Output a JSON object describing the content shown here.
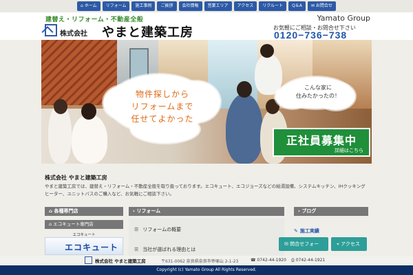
{
  "nav": {
    "items": [
      {
        "icon": "home-icon",
        "glyph": "🏠",
        "label": "ホーム"
      },
      {
        "icon": "",
        "glyph": "",
        "label": "リフォーム"
      },
      {
        "icon": "",
        "glyph": "",
        "label": "施工事例"
      },
      {
        "icon": "",
        "glyph": "",
        "label": "ご挨拶"
      },
      {
        "icon": "",
        "glyph": "",
        "label": "会社情報"
      },
      {
        "icon": "",
        "glyph": "",
        "label": "営業エリア"
      },
      {
        "icon": "",
        "glyph": "",
        "label": "アクセス"
      },
      {
        "icon": "",
        "glyph": "",
        "label": "リクルート"
      },
      {
        "icon": "",
        "glyph": "",
        "label": "Q＆A"
      },
      {
        "icon": "mail-icon",
        "glyph": "✉",
        "label": "お問合せ"
      }
    ]
  },
  "header": {
    "tagline": "建替え・リフォーム・不動産全般",
    "company_prefix": "株式会社",
    "company_name": "やまと建築工房",
    "group": "Yamato Group",
    "contact_hint": "お気軽にご相談・お問合せ下さい",
    "phone": "0120−736−738"
  },
  "hero": {
    "cloud_text": "物件探しから\nリフォームまで\n任せてよかった",
    "cloud2_text": "こんな家に\n住みたかったの！",
    "recruit_title": "正社員募集中",
    "recruit_sub": "詳細はこちら"
  },
  "intro": {
    "title": "株式会社 やまと建築工房",
    "body": "やまと建築工房では、建替え・リフォーム・不動産全般を取り扱っております。エコキュート、エコジョーズなどの給湯設備、システムキッチン、IHクッキングヒーター、ユニットバスのご購入など、お気軽にご相談下さい。"
  },
  "columns": {
    "left_title": "各種専門店",
    "left_sub": "エコキュート専門店",
    "left_small": "エコキュート",
    "left_banner": "エコキュート",
    "mid_title": "リフォーム",
    "mid_items": [
      "リフォームの概要",
      "当社が選ばれる理由とは"
    ],
    "right_title": "ブログ",
    "right_item": "施工実績"
  },
  "fab": {
    "contact": "問合せフォーム",
    "access": "アクセス"
  },
  "footer": {
    "name": "株式会社 やまと建築工房",
    "address": "〒631-0062 奈良県奈良市帝塚山 2-1-23",
    "tel": "0742-44-1920",
    "fax": "0742-44-1921",
    "copyright": "Copyright (c) Yamato Group All Rights Reserved."
  },
  "colors": {
    "nav": "#2d5aa6",
    "accent_green": "#3a8a2f",
    "phone_blue": "#1f56a9",
    "footer_navy": "#0d2f65",
    "cloud_text": "#e06a14",
    "recruit_green": "#1f8f3a",
    "fab_teal": "#2e9e99"
  }
}
